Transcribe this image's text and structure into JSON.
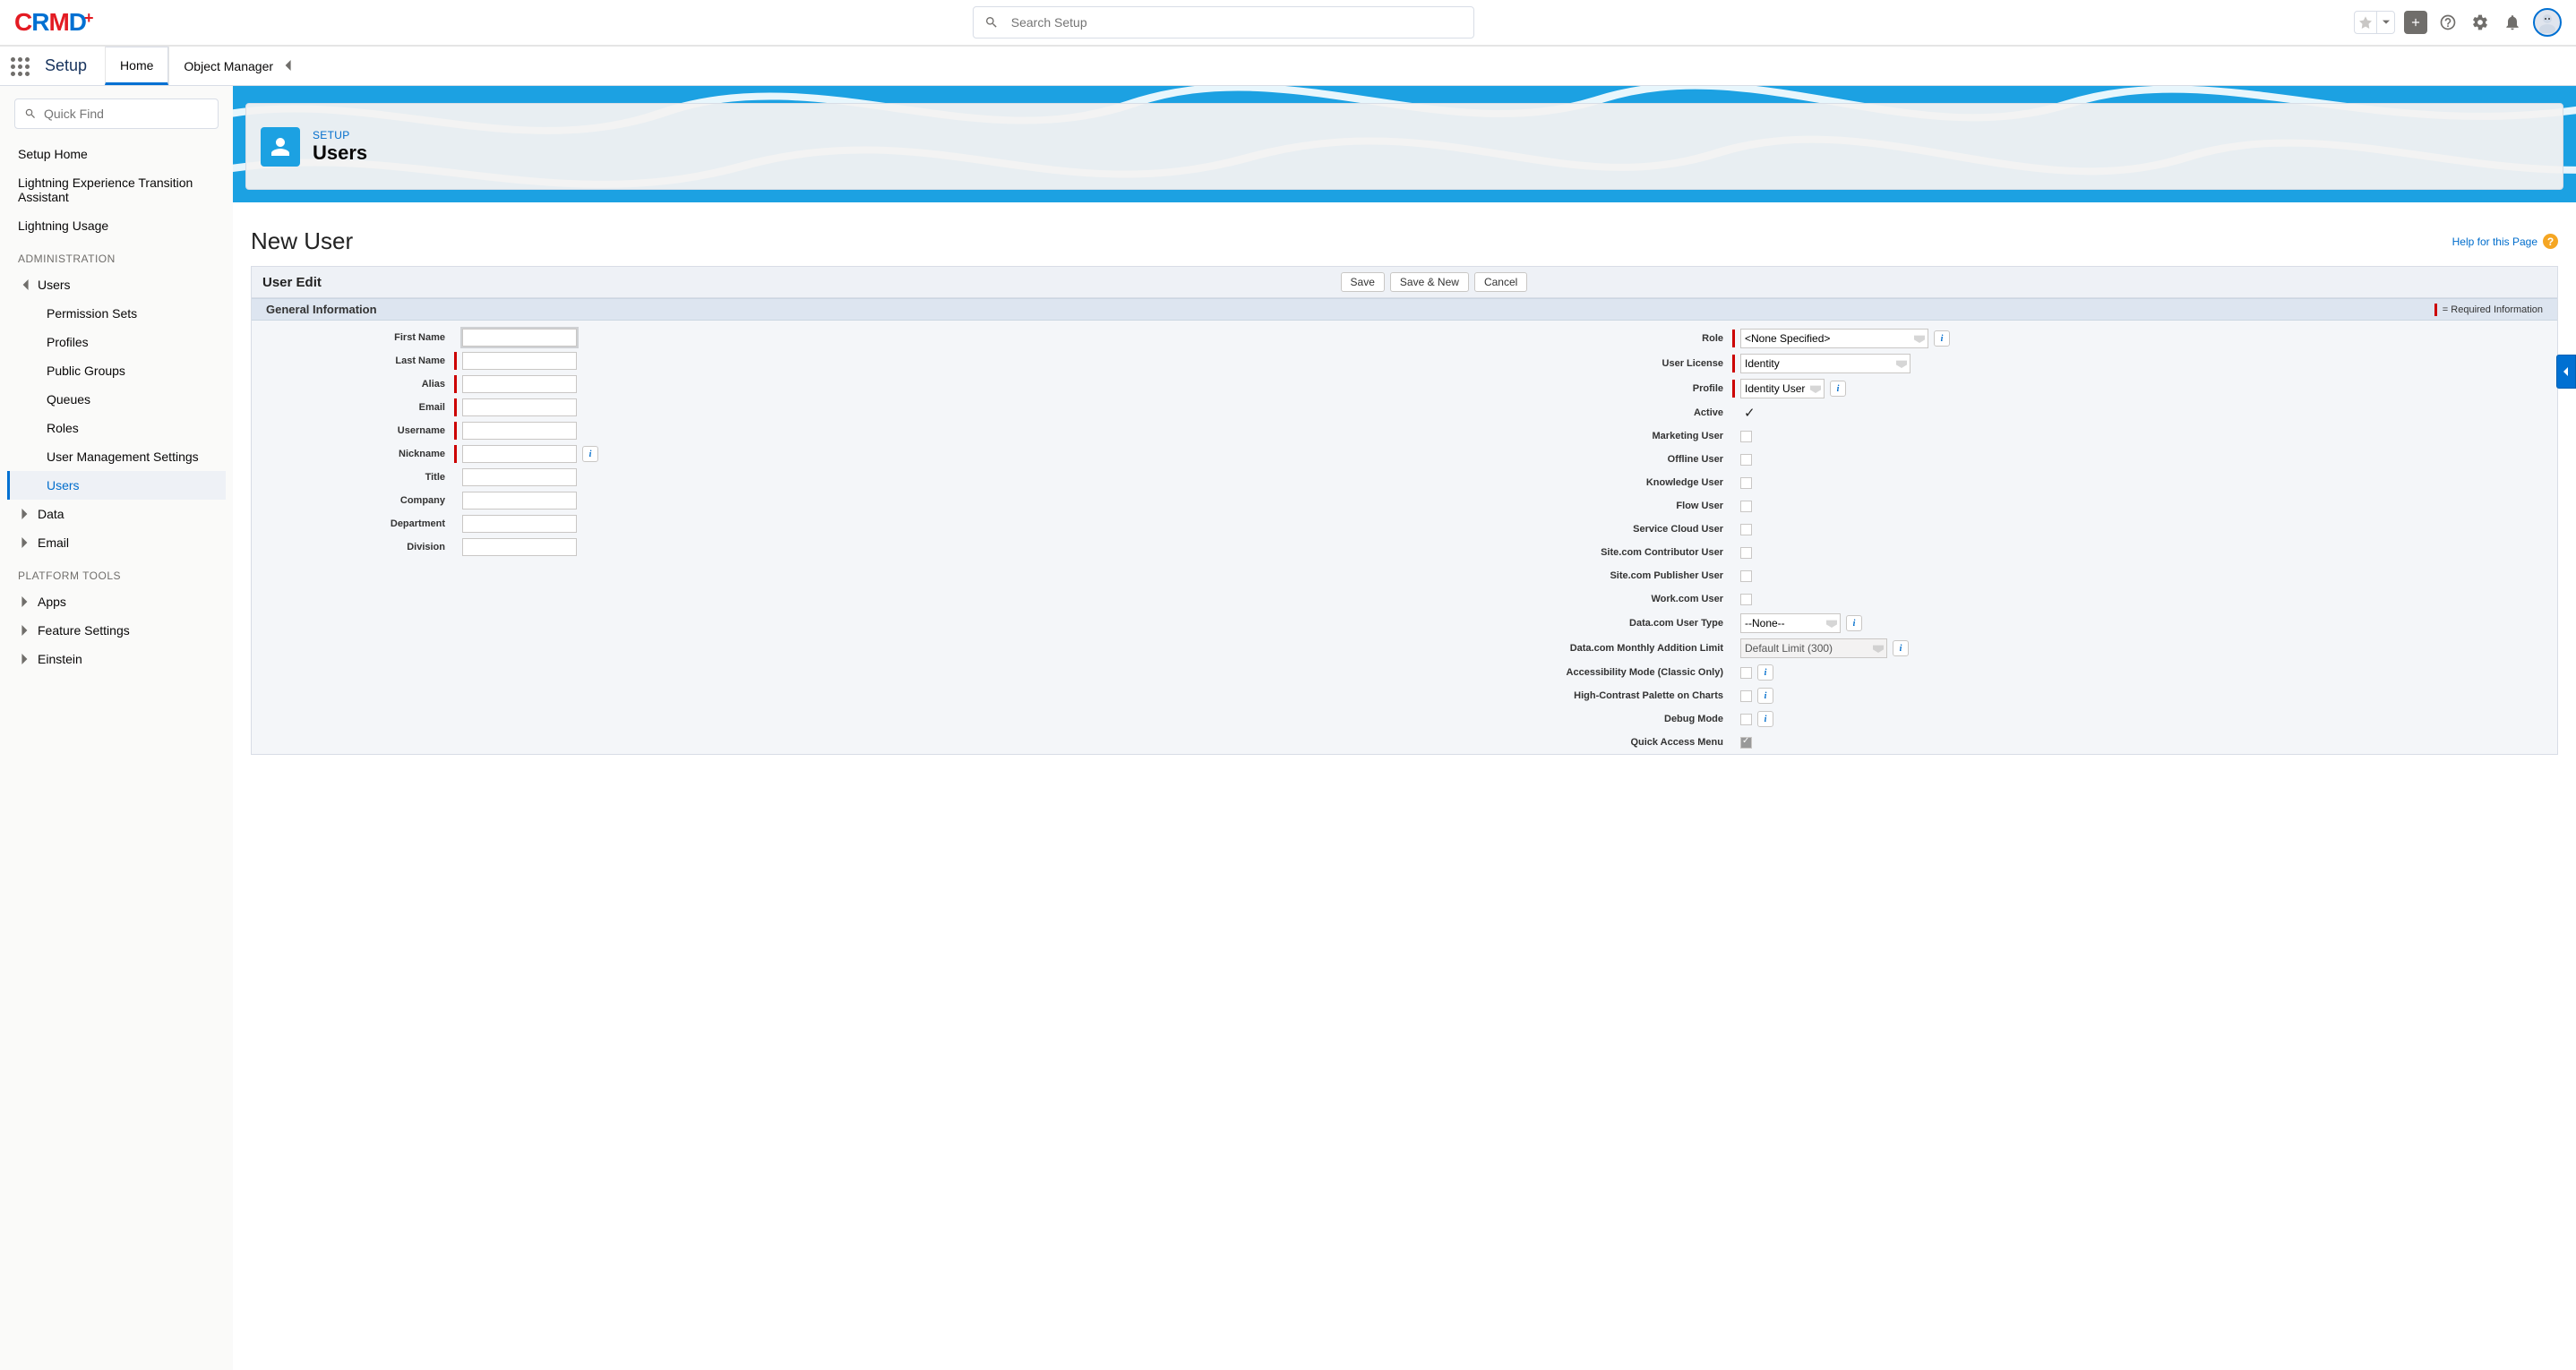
{
  "header": {
    "search_placeholder": "Search Setup"
  },
  "context": {
    "app_name": "Setup",
    "tab_home": "Home",
    "tab_object_manager": "Object Manager"
  },
  "sidebar": {
    "quick_find_placeholder": "Quick Find",
    "setup_home": "Setup Home",
    "lex_assistant": "Lightning Experience Transition Assistant",
    "lightning_usage": "Lightning Usage",
    "section_admin": "ADMINISTRATION",
    "users_parent": "Users",
    "users_children": {
      "permission_sets": "Permission Sets",
      "profiles": "Profiles",
      "public_groups": "Public Groups",
      "queues": "Queues",
      "roles": "Roles",
      "user_mgmt": "User Management Settings",
      "users": "Users"
    },
    "data": "Data",
    "email": "Email",
    "section_platform": "PLATFORM TOOLS",
    "apps": "Apps",
    "feature_settings": "Feature Settings",
    "einstein": "Einstein"
  },
  "hero": {
    "eyebrow": "SETUP",
    "title": "Users"
  },
  "page": {
    "title": "New User",
    "help_link": "Help for this Page"
  },
  "panel": {
    "title": "User Edit",
    "btn_save": "Save",
    "btn_save_new": "Save & New",
    "btn_cancel": "Cancel",
    "section_general": "General Information",
    "required_note": "= Required Information"
  },
  "form": {
    "left": {
      "first_name": "First Name",
      "last_name": "Last Name",
      "alias": "Alias",
      "email": "Email",
      "username": "Username",
      "nickname": "Nickname",
      "title": "Title",
      "company": "Company",
      "department": "Department",
      "division": "Division"
    },
    "right": {
      "role": "Role",
      "role_value": "<None Specified>",
      "user_license": "User License",
      "user_license_value": "Identity",
      "profile": "Profile",
      "profile_value": "Identity User",
      "active": "Active",
      "marketing_user": "Marketing User",
      "offline_user": "Offline User",
      "knowledge_user": "Knowledge User",
      "flow_user": "Flow User",
      "service_cloud_user": "Service Cloud User",
      "site_contrib": "Site.com Contributor User",
      "site_pub": "Site.com Publisher User",
      "work_user": "Work.com User",
      "data_user_type": "Data.com User Type",
      "data_user_type_value": "--None--",
      "data_limit": "Data.com Monthly Addition Limit",
      "data_limit_value": "Default Limit (300)",
      "accessibility": "Accessibility Mode (Classic Only)",
      "high_contrast": "High-Contrast Palette on Charts",
      "debug_mode": "Debug Mode",
      "quick_access": "Quick Access Menu"
    }
  }
}
